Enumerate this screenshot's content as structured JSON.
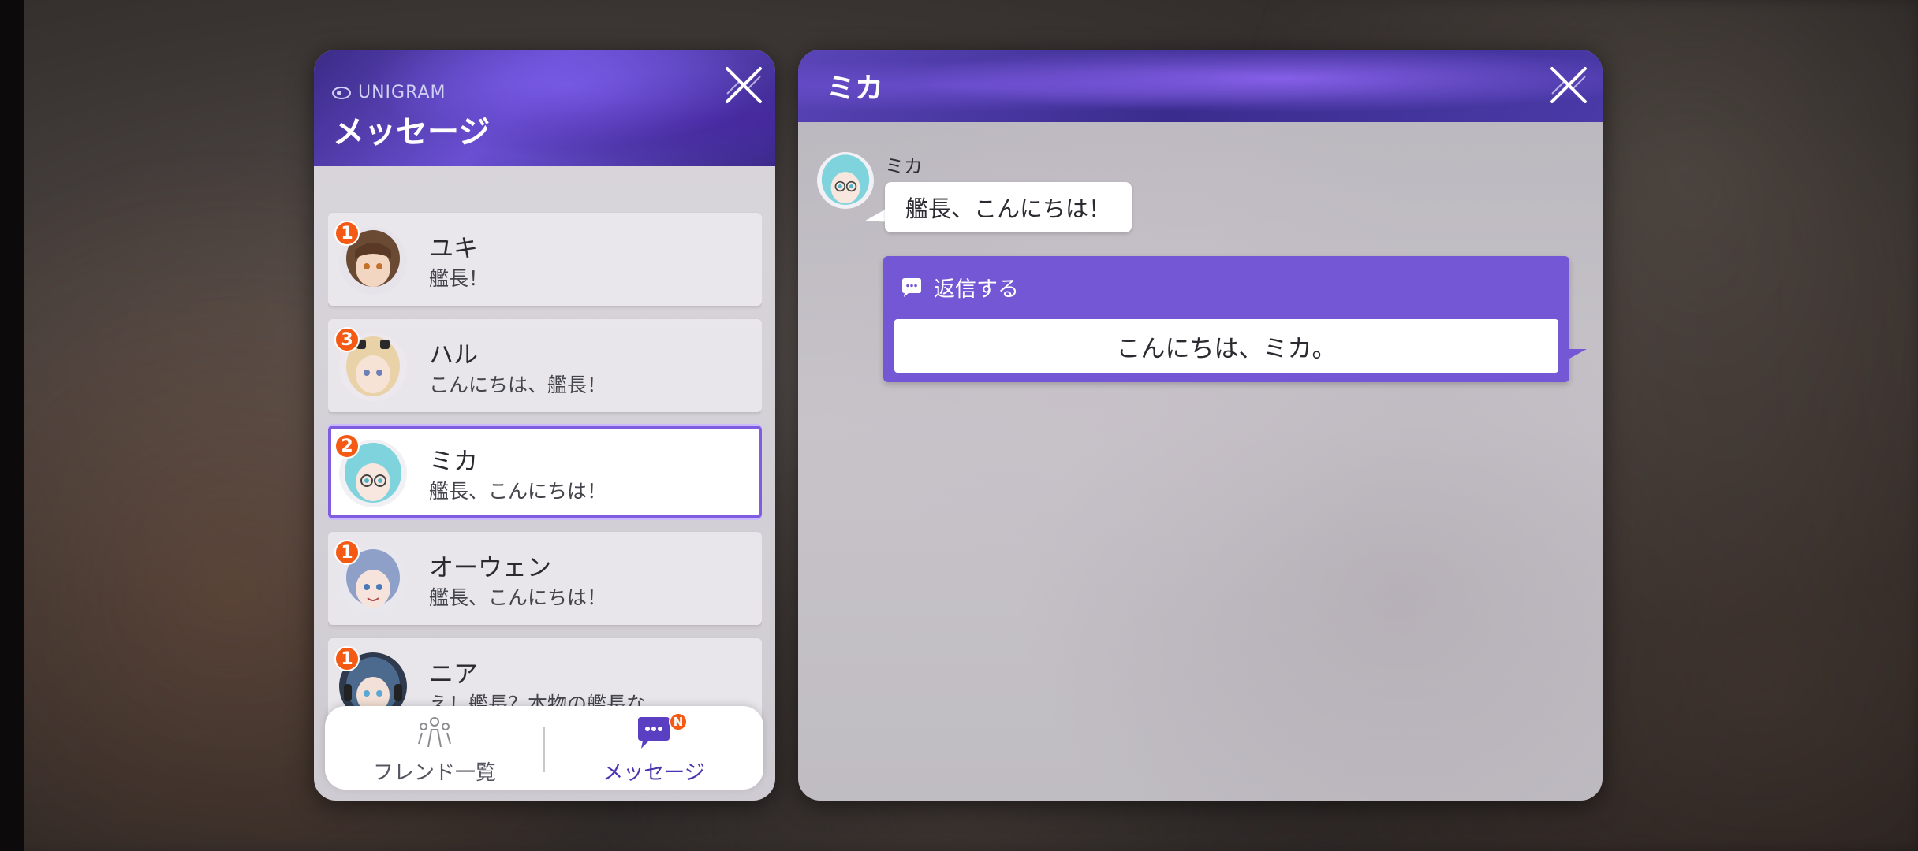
{
  "messages_panel": {
    "brand": "UNIGRAM",
    "title": "メッセージ"
  },
  "conversations": [
    {
      "name": "ユキ",
      "preview": "艦長！",
      "unread": "1",
      "avatar": "yuki-avatar"
    },
    {
      "name": "ハル",
      "preview": "こんにちは、艦長！",
      "unread": "3",
      "avatar": "haru-avatar"
    },
    {
      "name": "ミカ",
      "preview": "艦長、こんにちは！",
      "unread": "2",
      "avatar": "mika-avatar",
      "selected": true
    },
    {
      "name": "オーウェン",
      "preview": "艦長、こんにちは！",
      "unread": "1",
      "avatar": "owen-avatar"
    },
    {
      "name": "ニア",
      "preview": "え！艦長？本物の艦長な…",
      "unread": "1",
      "avatar": "nia-avatar"
    }
  ],
  "nav": {
    "friends_label": "フレンド一覧",
    "messages_label": "メッセージ",
    "messages_badge": "N"
  },
  "chat": {
    "title": "ミカ",
    "sender": "ミカ",
    "message": "艦長、こんにちは！",
    "reply_header": "返信する",
    "reply_option": "こんにちは、ミカ。"
  },
  "colors": {
    "accent": "#7457d4",
    "badge": "#f45a14",
    "header_purple": "#5a45b8"
  }
}
